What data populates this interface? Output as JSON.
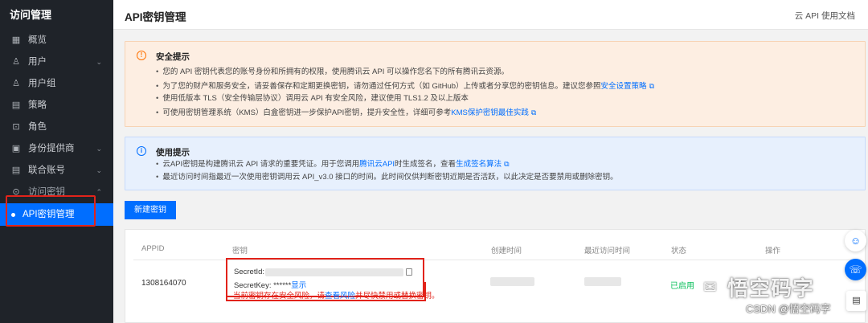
{
  "sidebar": {
    "title": "访问管理",
    "items": [
      {
        "label": "概览",
        "icon": "▦"
      },
      {
        "label": "用户",
        "icon": "♙",
        "chevron": "⌄"
      },
      {
        "label": "用户组",
        "icon": "♙"
      },
      {
        "label": "策略",
        "icon": "▤"
      },
      {
        "label": "角色",
        "icon": "⊡"
      },
      {
        "label": "身份提供商",
        "icon": "▣",
        "chevron": "⌄"
      },
      {
        "label": "联合账号",
        "icon": "▤",
        "chevron": "⌄"
      },
      {
        "label": "访问密钥",
        "icon": "⊙",
        "chevron": "⌃"
      }
    ],
    "active_sub": "API密钥管理"
  },
  "header": {
    "title": "API密钥管理",
    "doc_link": "云 API 使用文档"
  },
  "security_tip": {
    "icon": "!",
    "title": "安全提示",
    "lines": [
      {
        "text": "您的 API 密钥代表您的账号身份和所拥有的权限，使用腾讯云 API 可以操作您名下的所有腾讯云资源。"
      },
      {
        "text": "为了您的财产和服务安全，请妥善保存和定期更换密钥，请勿通过任何方式（如 GitHub）上传或者分享您的密钥信息。建议您参照",
        "link": "安全设置策略"
      },
      {
        "text": "使用低版本 TLS（安全传输层协议）调用云 API 有安全风险，建议使用 TLS1.2 及以上版本"
      },
      {
        "text": "可使用密钥管理系统（KMS）白盒密钥进一步保护API密钥，提升安全性，详细可参考",
        "link": "KMS保护密钥最佳实践"
      }
    ]
  },
  "usage_tip": {
    "icon": "i",
    "title": "使用提示",
    "line1_a": "云API密钥是构建腾讯云 API 请求的重要凭证。用于您调用",
    "line1_link1": "腾讯云API",
    "line1_b": "时生成签名，查看",
    "line1_link2": "生成签名算法",
    "line2": "最近访问时间指最近一次使用密钥调用云 API_v3.0 接口的时间。此时间仅供判断密钥近期是否活跃，以此决定是否要禁用或删除密钥。"
  },
  "new_key_button": "新建密钥",
  "table": {
    "columns": [
      "APPID",
      "密钥",
      "创建时间",
      "最近访问时间",
      "状态",
      "操作"
    ],
    "row": {
      "appid": "1308164070",
      "secret_id_label": "SecretId:",
      "secret_key_label": "SecretKey: ******",
      "show_link": "显示",
      "status": "已启用",
      "warning_a": "当前密钥存在安全风险，请",
      "warning_link": "查看风险",
      "warning_b": "并尽快禁用或替换密钥。"
    }
  },
  "watermark": {
    "main": "悟空码字",
    "sub": "CSDN @悟空码字"
  },
  "colors": {
    "sidebar_bg": "#1f2329",
    "accent": "#006eff",
    "warn_bg": "#fdeee2",
    "info_bg": "#e7f0fd",
    "highlight_red": "#e2231a",
    "status_green": "#0abf5b"
  }
}
